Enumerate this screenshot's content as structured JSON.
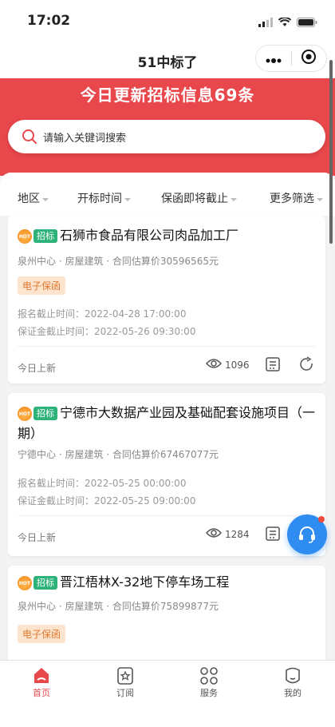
{
  "status_bar": {
    "time": "17:02",
    "icons": [
      "signal-icon",
      "wifi-icon",
      "battery-icon"
    ]
  },
  "nav": {
    "title": "51中标了",
    "more_icon": "more-icon",
    "close_icon": "target-icon"
  },
  "banner": {
    "headline": "今日更新招标信息69条",
    "bg_color": "#e8474b"
  },
  "search": {
    "placeholder": "请输入关键词搜索",
    "icon": "search-icon"
  },
  "filters": [
    {
      "label": "地区"
    },
    {
      "label": "开标时间"
    },
    {
      "label": "保函即将截止"
    },
    {
      "label": "更多筛选"
    }
  ],
  "cards": [
    {
      "tag": "招标",
      "hot": "HOT",
      "title": "石狮市食品有限公司肉品加工厂",
      "meta": "泉州中心 · 房屋建筑 · 合同估算价30596565元",
      "badge": "电子保函",
      "deadline_signup": "报名截止时间：2022-04-28 17:00:00",
      "deadline_deposit": "保证金截止时间：2022-05-26 09:30:00",
      "footer": "今日上新",
      "views": "1096"
    },
    {
      "tag": "招标",
      "hot": "HOT",
      "title": "宁德市大数据产业园及基础配套设施项目（一期）",
      "meta": "宁德中心 · 房屋建筑 · 合同估算价67467077元",
      "deadline_signup": "报名截止时间：2022-05-25 00:00:00",
      "deadline_deposit": "保证金截止时间：2022-05-25 09:00:00",
      "footer": "今日上新",
      "views": "1284"
    },
    {
      "tag": "招标",
      "hot": "HOT",
      "title": "晋江梧林X-32地下停车场工程",
      "meta": "泉州中心 · 房屋建筑 · 合同估算价75899877元",
      "badge": "电子保函"
    }
  ],
  "tabbar": [
    {
      "label": "首页",
      "icon": "home-icon",
      "active": true
    },
    {
      "label": "订阅",
      "icon": "subscribe-icon"
    },
    {
      "label": "服务",
      "icon": "services-icon"
    },
    {
      "label": "我的",
      "icon": "profile-icon"
    }
  ],
  "colors": {
    "accent": "#e8474b",
    "tag_green": "#2db37a",
    "badge_orange": "#e07a2f",
    "float_blue": "#2f8cf0"
  }
}
